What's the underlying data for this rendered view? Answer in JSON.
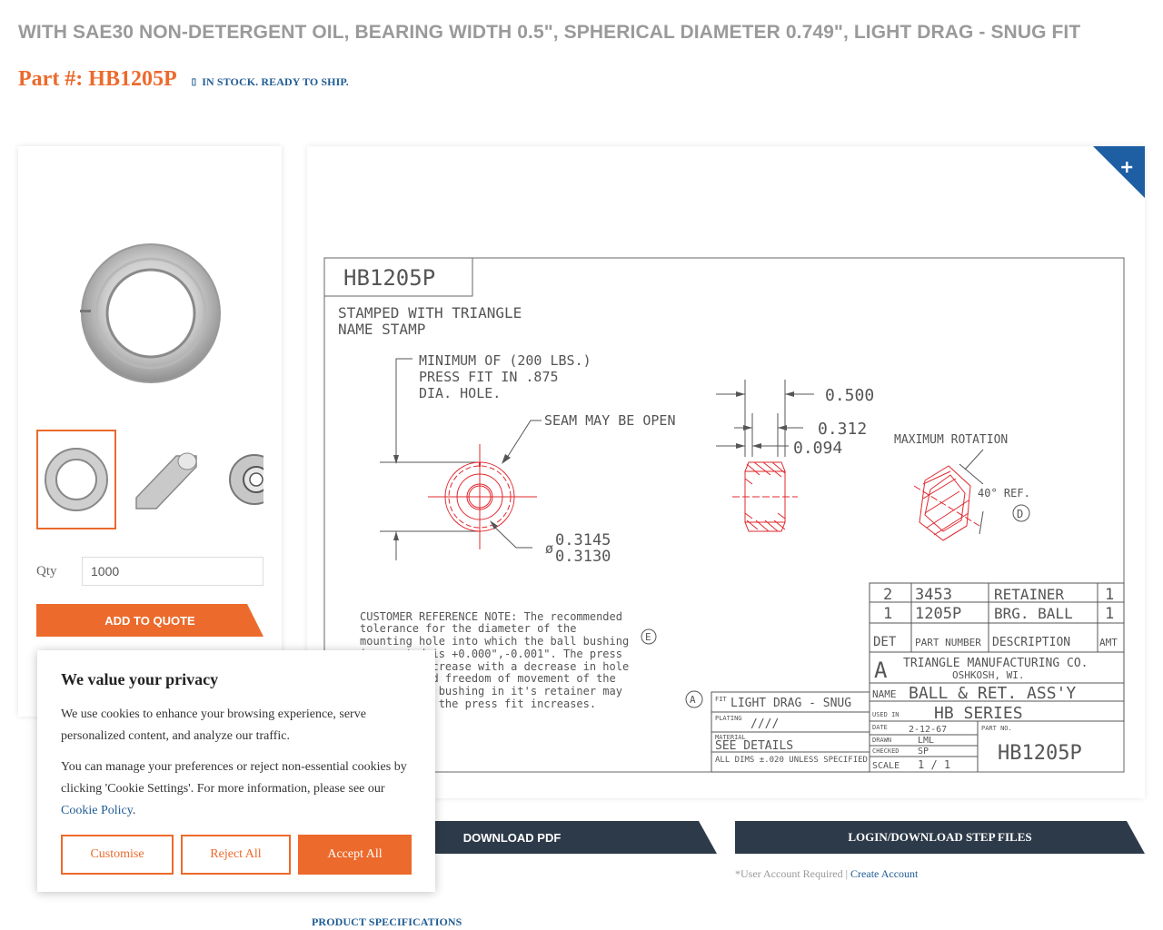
{
  "header": {
    "subtitle": "WITH SAE30 NON-DETERGENT OIL, BEARING WIDTH 0.5\", SPHERICAL DIAMETER 0.749\", LIGHT DRAG - SNUG FIT",
    "part_number": "Part #: HB1205P",
    "stock_status": "IN STOCK. READY TO SHIP."
  },
  "product": {
    "qty_label": "Qty",
    "qty_value": "1000",
    "add_to_quote": "ADD TO QUOTE"
  },
  "drawing": {
    "title_box": "HB1205P",
    "stamp_note": [
      "STAMPED WITH TRIANGLE",
      "NAME STAMP"
    ],
    "press_fit_note": [
      "MINIMUM OF (200 LBS.)",
      "PRESS FIT IN .875",
      "DIA. HOLE."
    ],
    "seam_note": "SEAM MAY BE OPEN",
    "dim_width": "0.500",
    "dim_inner": "0.312",
    "dim_offset": "0.094",
    "max_rotation": "MAXIMUM ROTATION",
    "angle": "40° REF.",
    "bore_upper": "0.3145",
    "bore_lower": "0.3130",
    "bore_symbol": "ø",
    "customer_note": [
      "CUSTOMER REFERENCE NOTE:  The recommended",
      "tolerance for the diameter of the",
      "mounting hole into which the ball bushing",
      "is mounted is +0.000\",-0.001\".  The press",
      "fit will increase with a decrease in hole",
      "diameter and freedom of movement of the",
      "ball in the bushing in it's retainer may",
      "decrease as the press fit increases."
    ],
    "bom": [
      {
        "det": "2",
        "part": "3453",
        "desc": "RETAINER",
        "amt": "1"
      },
      {
        "det": "1",
        "part": "1205P",
        "desc": "BRG. BALL",
        "amt": "1"
      }
    ],
    "bom_headers": {
      "det": "DET",
      "part": "PART NUMBER",
      "desc": "DESCRIPTION",
      "amt": "AMT"
    },
    "company": "TRIANGLE MANUFACTURING CO.",
    "city": "OSHKOSH, WI.",
    "name_label": "NAME",
    "name_value": "BALL & RET. ASS'Y",
    "used_in_label": "USED IN",
    "used_in_value": "HB SERIES",
    "date_label": "DATE",
    "date_value": "2-12-67",
    "part_no_label": "PART NO.",
    "part_no_value": "HB1205P",
    "drawn_label": "DRAWN",
    "drawn_value": "LML",
    "checked_label": "CHECKED",
    "checked_value": "SP",
    "scale_label": "SCALE",
    "scale_value": "1 / 1",
    "fit_label": "FIT",
    "fit_value": "LIGHT DRAG - SNUG",
    "plating_label": "PLATING",
    "plating_value": "////",
    "material_label": "MATERIAL",
    "material_value": "SEE DETAILS",
    "tolerance_note": "ALL DIMS ±.020 UNLESS SPECIFIED",
    "callout_a": "A",
    "callout_d": "D",
    "callout_e": "E"
  },
  "downloads": {
    "pdf_label": "DOWNLOAD PDF",
    "step_label": "LOGIN/DOWNLOAD STEP FILES",
    "account_note": "*User Account Required | ",
    "create_account": "Create Account"
  },
  "specs_link": "PRODUCT SPECIFICATIONS",
  "cookie": {
    "title": "We value your privacy",
    "text1": "We use cookies to enhance your browsing experience, serve personalized content, and analyze our traffic.",
    "text2": "You can manage your preferences or reject non-essential cookies by clicking 'Cookie Settings'. For more information, please see our ",
    "policy_link": "Cookie Policy",
    "customise": "Customise",
    "reject": "Reject All",
    "accept": "Accept All"
  },
  "colors": {
    "accent_orange": "#ec6a2c",
    "link_blue": "#1f5c94",
    "dark_button": "#2d3a49",
    "drawing_red": "#e0282e"
  }
}
